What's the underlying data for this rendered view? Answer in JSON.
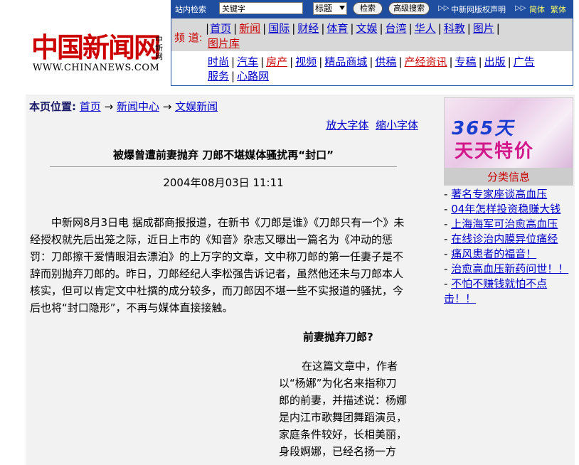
{
  "logo": {
    "cn": "中国新闻网",
    "side": "中新网",
    "en": "WWW.CHINANEWS.COM"
  },
  "search": {
    "label": "站内检索",
    "keyword_value": "关键字",
    "select_value": "标题",
    "search_button": "检索",
    "advanced_button": "高级搜索",
    "copyright_link": "中新网版权声明",
    "simplified": "简体",
    "traditional": "繁体"
  },
  "nav": {
    "label": "频 道:",
    "row1": [
      "首页",
      "新闻",
      "国际",
      "财经",
      "体育",
      "文娱",
      "台湾",
      "华人",
      "科教",
      "图片"
    ],
    "row1_wrap": "图片库",
    "row2": [
      "时尚",
      "汽车",
      "房产",
      "视频",
      "精品商城",
      "供稿",
      "产经资讯",
      "专稿",
      "出版",
      "广告"
    ],
    "row2_wrap": [
      "服务",
      "心路网"
    ]
  },
  "breadcrumb": {
    "label": "本页位置:",
    "items": [
      "首页",
      "新闻中心",
      "文娱新闻"
    ],
    "arrow": "→"
  },
  "font_controls": {
    "enlarge": "放大字体",
    "shrink": "缩小字体"
  },
  "article": {
    "title": "被爆曾遭前妻抛弃 刀郎不堪媒体骚扰再“封口”",
    "date": "2004年08月03日 11:11",
    "para1": "中新网8月3日电 据成都商报报道，在新书《刀郎是谁》《刀郎只有一个》未经授权就先后出笼之际，近日上市的《知音》杂志又曝出一篇名为《冲动的惩罚：刀郎擦干爱情眼泪去漂泊》的上万字的文章，文中称刀郎的第一任妻子是不辞而别抛弃刀郎的。昨日，刀郎经纪人李松强告诉记者，虽然他还未与刀郎本人核实，但可以肯定文中杜撰的成分较多，而刀郎因不堪一些不实报道的骚扰，今后也将“封口隐形”，不再与媒体直接接触。",
    "subhead": "前妻抛弃刀郎?",
    "para2": "在这篇文章中，作者以“杨娜”为化名来指称刀郎的前妻，并描述说：杨娜是内江市歌舞团舞蹈演员，家庭条件较好，长相美丽，身段婀娜，已经名扬一方"
  },
  "ad": {
    "line1": "365天",
    "line2": "天天特价"
  },
  "classified": {
    "heading": "分类信息",
    "items": [
      "著名专家座谈高血压",
      "04年怎样投资稳赚大钱",
      "上海海军可治愈高血压",
      "在线诊治内膜异位痛经",
      "痛风患者的福音！",
      "治愈高血压新药问世！！",
      "不怕不赚钱就怕不点击！！"
    ],
    "dash": "-"
  }
}
